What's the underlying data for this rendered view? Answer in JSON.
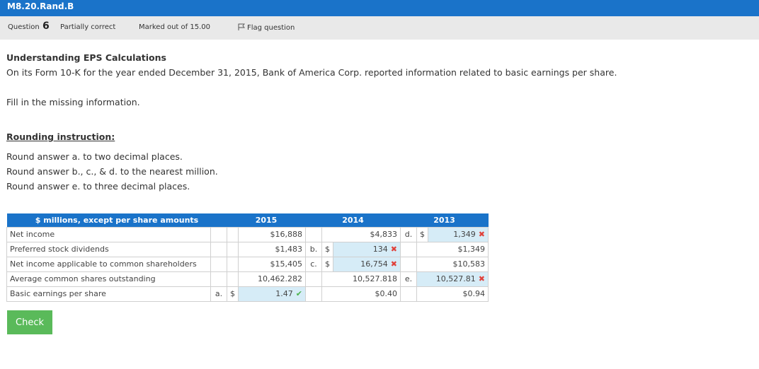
{
  "top_title": "M8.20.Rand.B",
  "info": {
    "question_label": "Question",
    "question_number": "6",
    "status": "Partially correct",
    "marks": "Marked out of 15.00",
    "flag": "Flag question"
  },
  "body": {
    "heading": "Understanding EPS Calculations",
    "intro": "On its Form 10-K for the year ended December 31, 2015, Bank of America Corp. reported information related to basic earnings per share.",
    "fill": "Fill in the missing information.",
    "rounding_heading": "Rounding instruction:",
    "rounding_a": "Round answer a. to two decimal places.",
    "rounding_bcd": "Round answer b., c., & d. to the nearest million.",
    "rounding_e": "Round answer e. to three decimal places."
  },
  "table": {
    "header": {
      "label": "$ millions, except per share amounts",
      "y2015": "2015",
      "y2014": "2014",
      "y2013": "2013"
    },
    "rows": [
      {
        "label": "Net income",
        "c2015": "$16,888",
        "c2014": "$4,833",
        "l2013": "d.",
        "s2013": "$",
        "c2013": "1,349"
      },
      {
        "label": "Preferred stock dividends",
        "c2015": "$1,483",
        "l2014": "b.",
        "s2014": "$",
        "c2014": "134",
        "c2013": "$1,349"
      },
      {
        "label": "Net income applicable to common shareholders",
        "c2015": "$15,405",
        "l2014": "c.",
        "s2014": "$",
        "c2014": "16,754",
        "c2013": "$10,583"
      },
      {
        "label": "Average common shares outstanding",
        "c2015": "10,462.282",
        "c2014": "10,527.818",
        "l2013": "e.",
        "c2013": "10,527.81"
      },
      {
        "label": "Basic earnings per share",
        "l2015": "a.",
        "s2015": "$",
        "c2015": "1.47",
        "c2014": "$0.40",
        "c2013": "$0.94"
      }
    ]
  },
  "marks": {
    "wrong": "✖",
    "right": "✔"
  },
  "check_button": "Check",
  "colors": {
    "primary": "#1a73c9",
    "answer_bg": "#d6ecf7",
    "wrong": "#e0413a",
    "right": "#4bb34b",
    "button": "#5aba5a"
  }
}
